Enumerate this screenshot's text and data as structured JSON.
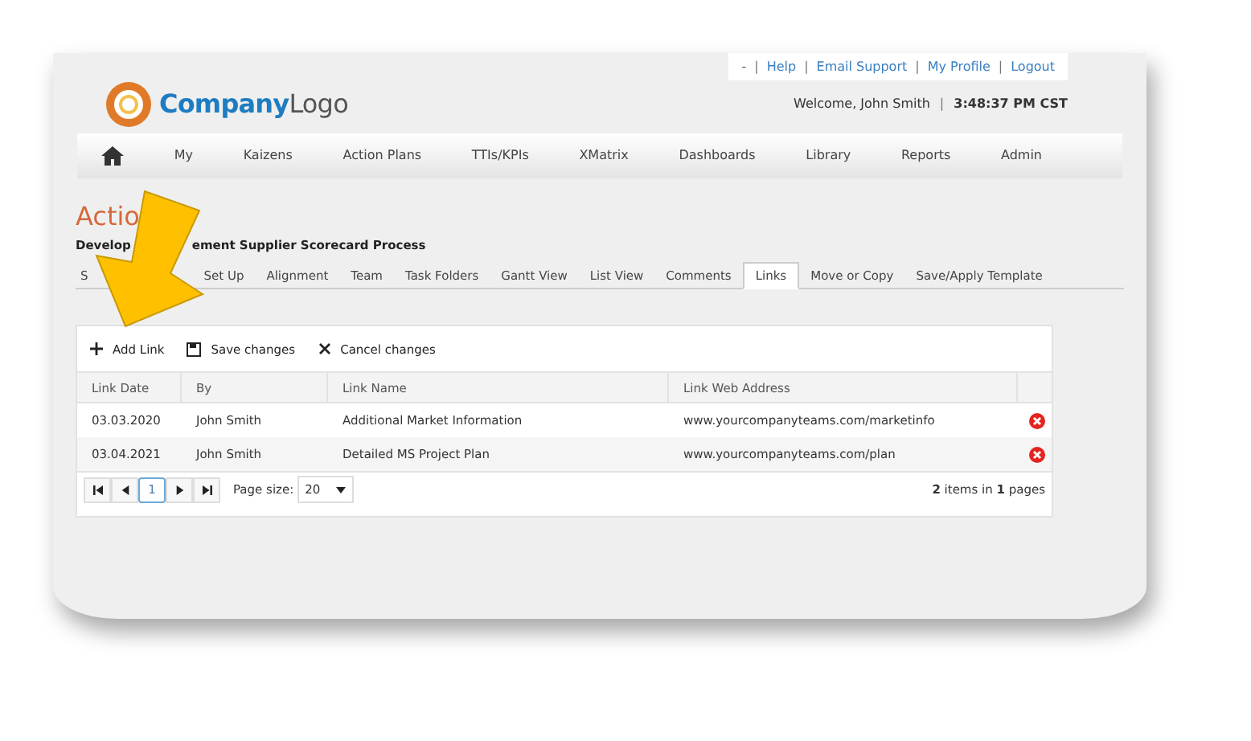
{
  "header": {
    "links": [
      "-",
      "Help",
      "Email Support",
      "My Profile",
      "Logout"
    ],
    "separator": "|",
    "logo": {
      "part_1": "Company",
      "part_2": "Logo"
    },
    "welcome": "Welcome, John Smith",
    "clock": "3:48:37 PM CST"
  },
  "nav": [
    "My",
    "Kaizens",
    "Action Plans",
    "TTIs/KPIs",
    "XMatrix",
    "Dashboards",
    "Library",
    "Reports",
    "Admin"
  ],
  "page": {
    "title": "Actio",
    "subtitle_parts": [
      "Develop",
      "ement Supplier Scorecard Process"
    ]
  },
  "tabs": [
    {
      "label": "S",
      "selected": false
    },
    {
      "label": "Set Up",
      "selected": false
    },
    {
      "label": "Alignment",
      "selected": false
    },
    {
      "label": "Team",
      "selected": false
    },
    {
      "label": "Task Folders",
      "selected": false
    },
    {
      "label": "Gantt View",
      "selected": false
    },
    {
      "label": "List View",
      "selected": false
    },
    {
      "label": "Comments",
      "selected": false
    },
    {
      "label": "Links",
      "selected": true
    },
    {
      "label": "Move or Copy",
      "selected": false
    },
    {
      "label": "Save/Apply Template",
      "selected": false
    }
  ],
  "toolbar": [
    {
      "label": "Add Link",
      "kind": "add"
    },
    {
      "label": "Save changes",
      "kind": "save"
    },
    {
      "label": "Cancel changes",
      "kind": "cancel"
    }
  ],
  "table": {
    "columns": [
      "Link Date",
      "By",
      "Link Name",
      "Link Web Address"
    ],
    "rows": [
      {
        "cells": [
          "03.03.2020",
          "John Smith",
          "Additional Market Information",
          "www.yourcompanyteams.com/marketinfo"
        ]
      },
      {
        "cells": [
          "03.04.2021",
          "John Smith",
          "Detailed MS Project Plan",
          "www.yourcompanyteams.com/plan"
        ]
      }
    ]
  },
  "pager": {
    "current_page": "1",
    "page_size_label": "Page size:",
    "page_size": "20",
    "summary": "**2** items in **1** pages"
  }
}
